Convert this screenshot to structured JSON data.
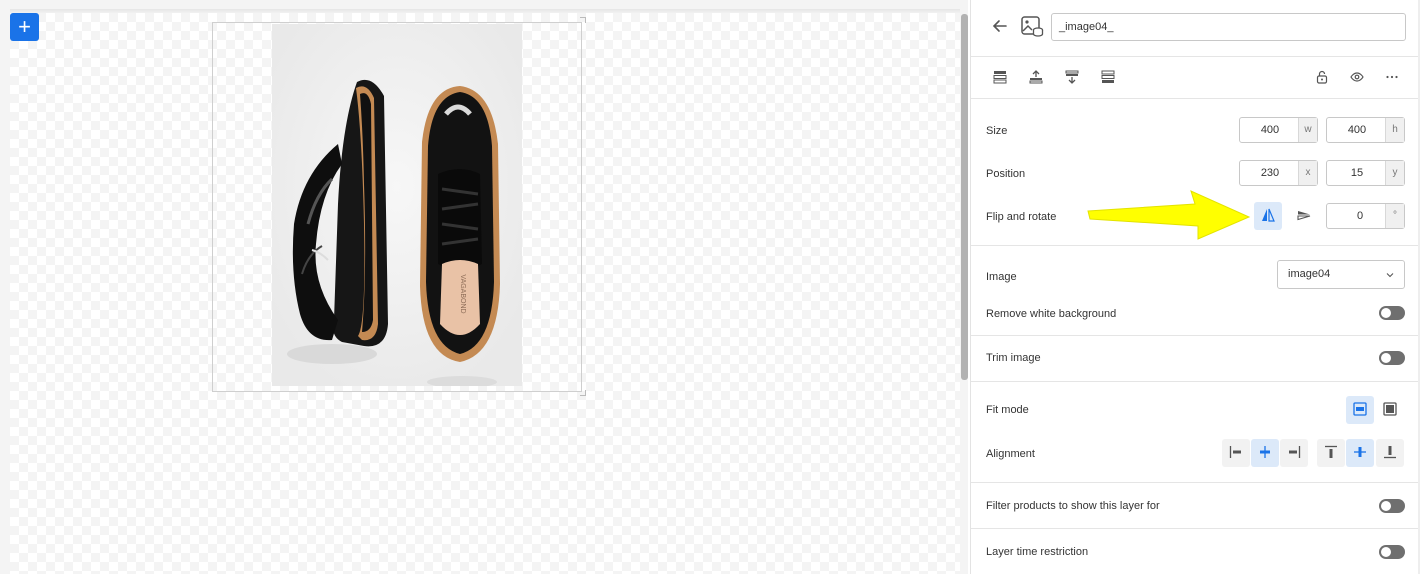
{
  "layer": {
    "name": "_image04_"
  },
  "size": {
    "label": "Size",
    "w": "400",
    "w_unit": "w",
    "h": "400",
    "h_unit": "h"
  },
  "position": {
    "label": "Position",
    "x": "230",
    "x_unit": "x",
    "y": "15",
    "y_unit": "y"
  },
  "flip": {
    "label": "Flip and rotate",
    "angle": "0",
    "angle_unit": "°"
  },
  "image": {
    "label": "Image",
    "selected": "image04"
  },
  "remove_bg": {
    "label": "Remove white background"
  },
  "trim": {
    "label": "Trim image"
  },
  "fit": {
    "label": "Fit mode"
  },
  "alignment": {
    "label": "Alignment"
  },
  "filter": {
    "label": "Filter products to show this layer for"
  },
  "time": {
    "label": "Layer time restriction"
  },
  "insole_text": "VAGABOND",
  "colors": {
    "accent": "#1a73e8",
    "highlight": "#ffff00",
    "active_bg": "#dce9f9"
  }
}
